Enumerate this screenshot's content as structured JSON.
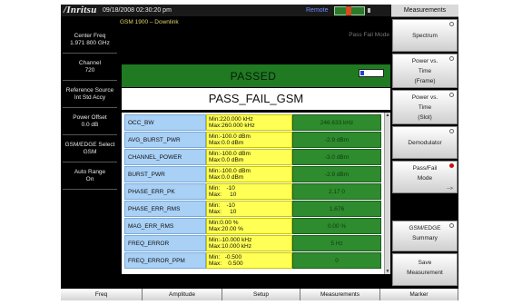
{
  "header": {
    "logo": "/Inritsu",
    "datetime": "09/18/2008 02:30:20 pm",
    "remote_label": "Remote"
  },
  "main": {
    "standard": "GSM 1900 – Downlink",
    "mode_label": "Pass Fail Mode",
    "status": "PASSED",
    "test_title": "PASS_FAIL_GSM"
  },
  "left_panel": [
    {
      "label": "Center Freq",
      "value": "1.971 800 GHz"
    },
    {
      "label": "Channel",
      "value": "720"
    },
    {
      "label": "Reference Source",
      "value": "Int Std Accy"
    },
    {
      "label": "Power Offset",
      "value": "0.0 dB"
    },
    {
      "label": "GSM/EDGE Select",
      "value": "GSM"
    },
    {
      "label": "Auto Range",
      "value": "On"
    }
  ],
  "table": {
    "rows": [
      {
        "name": "OCC_BW",
        "limits": "Min:220.000 kHz\nMax:260.000 kHz",
        "result": "246.633 kHz"
      },
      {
        "name": "AVG_BURST_PWR",
        "limits": "Min:-100.0 dBm\nMax:0.0 dBm",
        "result": "-2.9 dBm"
      },
      {
        "name": "CHANNEL_POWER",
        "limits": "Min:-100.0 dBm\nMax:0.0 dBm",
        "result": "-3.0 dBm"
      },
      {
        "name": "BURST_PWR",
        "limits": "Min:-100.0 dBm\nMax:0.0 dBm",
        "result": "-2.9 dBm"
      },
      {
        "name": "PHASE_ERR_PK",
        "limits": "Min:    -10\nMax:     10",
        "result": "2.17 0"
      },
      {
        "name": "PHASE_ERR_RMS",
        "limits": "Min:    -10\nMax:     10",
        "result": "1.676"
      },
      {
        "name": "MAG_ERR_RMS",
        "limits": "Min:0.00 %\nMax:20.00 %",
        "result": "0.00 %"
      },
      {
        "name": "FREQ_ERROR",
        "limits": "Min:-10.000 kHz\nMax:10.000 kHz",
        "result": "5 Hz"
      },
      {
        "name": "FREQ_ERROR_PPM",
        "limits": "Min:   -0.500\nMax:    0.500",
        "result": "0"
      }
    ]
  },
  "right_menu": {
    "title": "Measurements",
    "buttons": [
      {
        "line1": "Spectrum",
        "line2": "",
        "line3": ""
      },
      {
        "line1": "Power vs.",
        "line2": "Time",
        "line3": "(Frame)"
      },
      {
        "line1": "Power vs.",
        "line2": "Time",
        "line3": "(Slot)"
      },
      {
        "line1": "Demodulator",
        "line2": "",
        "line3": ""
      },
      {
        "line1": "Pass/Fail",
        "line2": "Mode",
        "line3": ""
      },
      {
        "line1": "GSM/EDGE",
        "line2": "Summary",
        "line3": ""
      },
      {
        "line1": "Save",
        "line2": "Measurement",
        "line3": ""
      }
    ],
    "submenu_arrow": "-->"
  },
  "bottom_menu": [
    "Freq",
    "Amplitude",
    "Setup",
    "Measurements",
    "Marker"
  ]
}
